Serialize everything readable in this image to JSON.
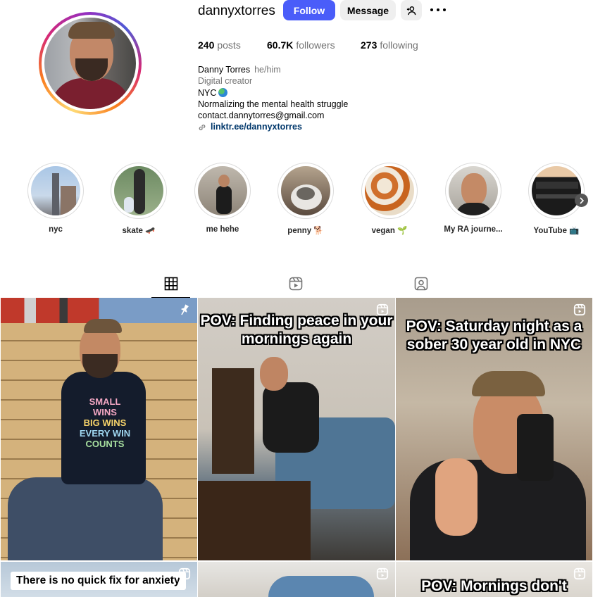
{
  "profile": {
    "username": "dannyxtorres",
    "follow_label": "Follow",
    "message_label": "Message",
    "stats": {
      "posts_count": "240",
      "posts_label": "posts",
      "followers_count": "60.7K",
      "followers_label": "followers",
      "following_count": "273",
      "following_label": "following"
    },
    "bio": {
      "name": "Danny Torres",
      "pronouns": "he/him",
      "category": "Digital creator",
      "location": "NYC",
      "line": "Normalizing the mental health struggle",
      "email": "contact.dannytorres@gmail.com",
      "link": "linktr.ee/dannyxtorres"
    }
  },
  "highlights": [
    {
      "label": "nyc"
    },
    {
      "label": "skate 🛹"
    },
    {
      "label": "me hehe"
    },
    {
      "label": "penny 🐕"
    },
    {
      "label": "vegan 🌱"
    },
    {
      "label": "My RA journe..."
    },
    {
      "label": "YouTube 📺"
    }
  ],
  "tabs": [
    "posts-tab",
    "reels-tab",
    "tagged-tab"
  ],
  "posts": [
    {
      "type": "pinned",
      "overlay": "",
      "shirt_lines": [
        "SMALL WINS",
        "BIG WINS",
        "EVERY WIN",
        "COUNTS"
      ]
    },
    {
      "type": "reel",
      "overlay": "POV: Finding peace in your mornings again"
    },
    {
      "type": "reel",
      "overlay": "POV: Saturday night as a sober 30 year old in NYC"
    },
    {
      "type": "reel",
      "overlay": "There is no quick fix for anxiety"
    },
    {
      "type": "reel",
      "overlay": ""
    },
    {
      "type": "reel",
      "overlay": "POV: Mornings don't"
    }
  ],
  "colors": {
    "follow_button": "#4a5df9",
    "secondary_button": "#efefef",
    "link": "#00376b",
    "muted_text": "#737373"
  }
}
